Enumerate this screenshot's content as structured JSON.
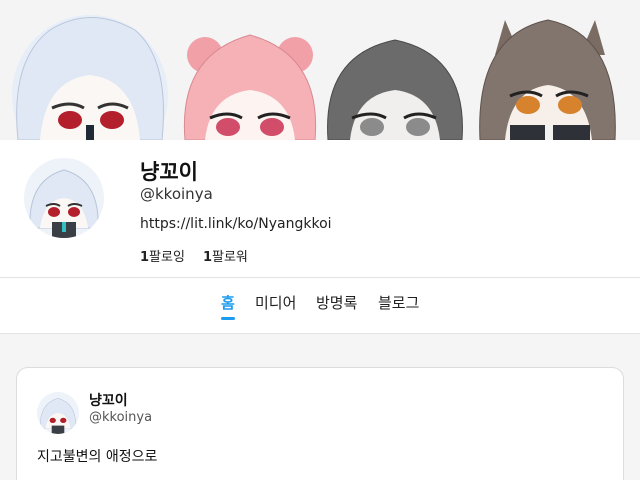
{
  "banner": {
    "characters": [
      "white-haired-character",
      "pink-haired-character",
      "gray-haired-character",
      "brown-haired-catgirl-character"
    ]
  },
  "profile": {
    "name": "냥꼬이",
    "handle": "@kkoinya",
    "link": "https://lit.link/ko/Nyangkkoi",
    "following_count": "1",
    "following_label": "팔로잉",
    "followers_count": "1",
    "followers_label": "팔로워"
  },
  "tabs": [
    {
      "label": "홈",
      "active": true
    },
    {
      "label": "미디어",
      "active": false
    },
    {
      "label": "방명록",
      "active": false
    },
    {
      "label": "블로그",
      "active": false
    }
  ],
  "post": {
    "name": "냥꼬이",
    "handle": "@kkoinya",
    "text": "지고불변의 애정으로"
  },
  "colors": {
    "accent": "#1d9bf0",
    "background": "#f5f5f6",
    "card": "#ffffff"
  }
}
